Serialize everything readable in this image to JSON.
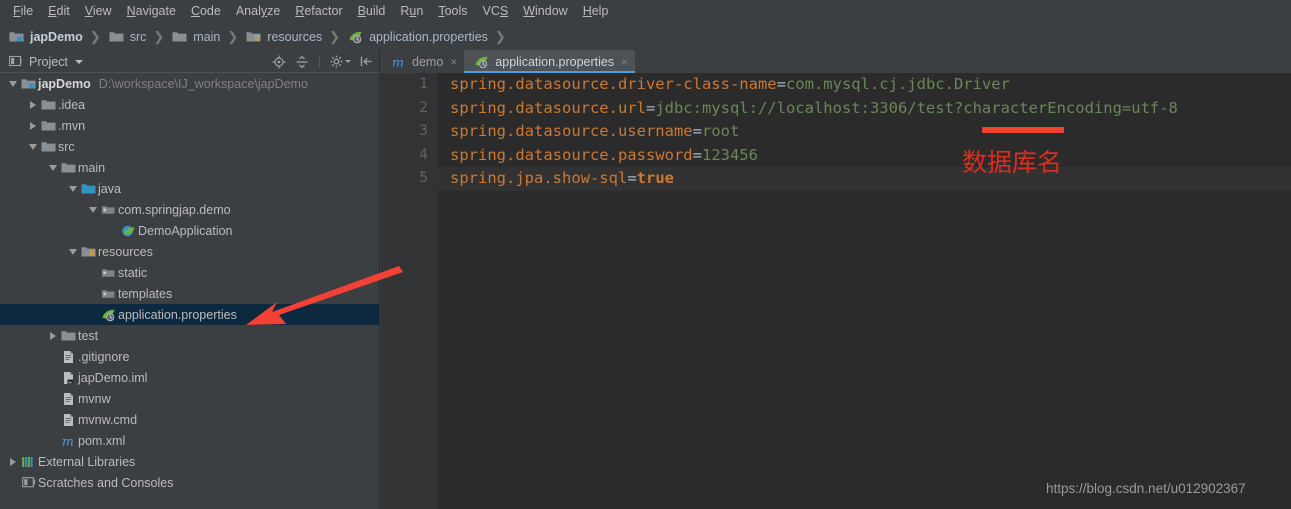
{
  "menubar": {
    "items": [
      {
        "label": "File",
        "mnemonic": "F"
      },
      {
        "label": "Edit",
        "mnemonic": "E"
      },
      {
        "label": "View",
        "mnemonic": "V"
      },
      {
        "label": "Navigate",
        "mnemonic": "N"
      },
      {
        "label": "Code",
        "mnemonic": "C"
      },
      {
        "label": "Analyze",
        "mnemonic": "y"
      },
      {
        "label": "Refactor",
        "mnemonic": "R"
      },
      {
        "label": "Build",
        "mnemonic": "B"
      },
      {
        "label": "Run",
        "mnemonic": "u"
      },
      {
        "label": "Tools",
        "mnemonic": "T"
      },
      {
        "label": "VCS",
        "mnemonic": "S"
      },
      {
        "label": "Window",
        "mnemonic": "W"
      },
      {
        "label": "Help",
        "mnemonic": "H"
      }
    ]
  },
  "breadcrumb": {
    "items": [
      {
        "label": "japDemo",
        "icon": "module-icon",
        "bold": true
      },
      {
        "label": "src",
        "icon": "folder-icon",
        "bold": false
      },
      {
        "label": "main",
        "icon": "folder-icon",
        "bold": false
      },
      {
        "label": "resources",
        "icon": "resources-folder-icon",
        "bold": false
      },
      {
        "label": "application.properties",
        "icon": "spring-leaf-icon",
        "bold": false
      }
    ],
    "separator": "❯"
  },
  "project_panel": {
    "title": "Project",
    "toolbar": [
      {
        "name": "locate-icon",
        "tooltip": "Select Opened File"
      },
      {
        "name": "collapse-all-icon",
        "tooltip": "Collapse All"
      },
      {
        "name": "gear-icon",
        "tooltip": "Settings"
      },
      {
        "name": "hide-panel-icon",
        "tooltip": "Hide"
      }
    ],
    "tree": [
      {
        "label": "japDemo",
        "path": "D:\\workspace\\IJ_workspace\\japDemo",
        "indent": 0,
        "twist": "down",
        "icon": "module-icon",
        "bold": true,
        "selected": false
      },
      {
        "label": ".idea",
        "path": "",
        "indent": 1,
        "twist": "right",
        "icon": "folder-icon",
        "bold": false,
        "selected": false
      },
      {
        "label": ".mvn",
        "path": "",
        "indent": 1,
        "twist": "right",
        "icon": "folder-icon",
        "bold": false,
        "selected": false
      },
      {
        "label": "src",
        "path": "",
        "indent": 1,
        "twist": "down",
        "icon": "folder-icon",
        "bold": false,
        "selected": false
      },
      {
        "label": "main",
        "path": "",
        "indent": 2,
        "twist": "down",
        "icon": "folder-icon",
        "bold": false,
        "selected": false
      },
      {
        "label": "java",
        "path": "",
        "indent": 3,
        "twist": "down",
        "icon": "source-folder-icon",
        "bold": false,
        "selected": false
      },
      {
        "label": "com.springjap.demo",
        "path": "",
        "indent": 4,
        "twist": "down",
        "icon": "package-icon",
        "bold": false,
        "selected": false
      },
      {
        "label": "DemoApplication",
        "path": "",
        "indent": 5,
        "twist": "none",
        "icon": "spring-class-icon",
        "bold": false,
        "selected": false
      },
      {
        "label": "resources",
        "path": "",
        "indent": 3,
        "twist": "down",
        "icon": "resources-folder-icon",
        "bold": false,
        "selected": false
      },
      {
        "label": "static",
        "path": "",
        "indent": 4,
        "twist": "none",
        "icon": "package-icon",
        "bold": false,
        "selected": false
      },
      {
        "label": "templates",
        "path": "",
        "indent": 4,
        "twist": "none",
        "icon": "package-icon",
        "bold": false,
        "selected": false
      },
      {
        "label": "application.properties",
        "path": "",
        "indent": 4,
        "twist": "none",
        "icon": "spring-leaf-icon",
        "bold": false,
        "selected": true
      },
      {
        "label": "test",
        "path": "",
        "indent": 2,
        "twist": "right",
        "icon": "folder-icon",
        "bold": false,
        "selected": false
      },
      {
        "label": ".gitignore",
        "path": "",
        "indent": 2,
        "twist": "none",
        "icon": "file-icon",
        "bold": false,
        "selected": false
      },
      {
        "label": "japDemo.iml",
        "path": "",
        "indent": 2,
        "twist": "none",
        "icon": "iml-file-icon",
        "bold": false,
        "selected": false
      },
      {
        "label": "mvnw",
        "path": "",
        "indent": 2,
        "twist": "none",
        "icon": "file-icon",
        "bold": false,
        "selected": false
      },
      {
        "label": "mvnw.cmd",
        "path": "",
        "indent": 2,
        "twist": "none",
        "icon": "file-icon",
        "bold": false,
        "selected": false
      },
      {
        "label": "pom.xml",
        "path": "",
        "indent": 2,
        "twist": "none",
        "icon": "maven-icon",
        "bold": false,
        "selected": false
      },
      {
        "label": "External Libraries",
        "path": "",
        "indent": 0,
        "twist": "right",
        "icon": "libraries-icon",
        "bold": false,
        "selected": false
      },
      {
        "label": "Scratches and Consoles",
        "path": "",
        "indent": 0,
        "twist": "none",
        "icon": "scratches-icon",
        "bold": false,
        "selected": false
      }
    ]
  },
  "editor": {
    "tabs": [
      {
        "label": "demo",
        "icon": "maven-icon",
        "active": false,
        "close": "×"
      },
      {
        "label": "application.properties",
        "icon": "spring-leaf-icon",
        "active": true,
        "close": "×"
      }
    ],
    "line_numbers": [
      "1",
      "2",
      "3",
      "4",
      "5"
    ],
    "lines": [
      {
        "key": "spring.datasource.driver-class-name",
        "eq": "=",
        "value": "com.mysql.cj.jdbc.Driver",
        "value_bold": false,
        "current": false
      },
      {
        "key": "spring.datasource.url",
        "eq": "=",
        "value": "jdbc:mysql://localhost:3306/test?characterEncoding=utf-8",
        "value_bold": false,
        "current": false
      },
      {
        "key": "spring.datasource.username",
        "eq": "=",
        "value": "root",
        "value_bold": false,
        "current": false
      },
      {
        "key": "spring.datasource.password",
        "eq": "=",
        "value": "123456",
        "value_bold": false,
        "current": false
      },
      {
        "key": "spring.jpa.show-sql",
        "eq": "=",
        "value": "true",
        "value_bold": true,
        "current": true
      }
    ]
  },
  "annotations": {
    "chinese_note": "数据库名",
    "underline_target": "test",
    "arrow_target": "application.properties",
    "accent_red": "#f34235",
    "note_red": "#e02b20"
  },
  "watermark": {
    "text": "https://blog.csdn.net/u012902367"
  },
  "colors": {
    "chrome_bg": "#3c3f41",
    "editor_bg": "#2b2b2b",
    "gutter_bg": "#313335",
    "selection_bg": "#0d293f",
    "tab_active_bg": "#4e5254",
    "tab_underline": "#4a9fe0",
    "key_orange": "#cc7832",
    "value_green": "#6a8759",
    "text": "#bbbbbb"
  }
}
